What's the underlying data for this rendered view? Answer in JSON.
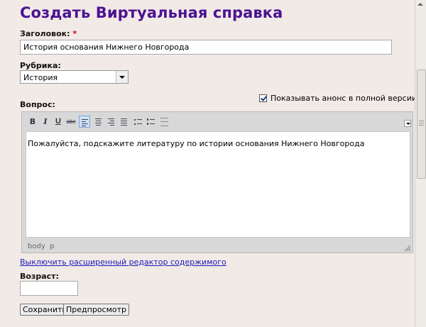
{
  "page": {
    "title": "Создать Виртуальная справка"
  },
  "form": {
    "heading_label": "Заголовок:",
    "required_mark": "*",
    "heading_value": "История основания Нижнего Новгорода",
    "rubric_label": "Рубрика:",
    "rubric_selected": "История",
    "show_preview_label": "Показывать анонс в полной версии",
    "question_label": "Вопрос:",
    "question_text": "Пожалуйста, подскажите литературу по истории основания Нижнего Новгорода",
    "status_body": "body",
    "status_p": "p",
    "advanced_editor_link": "Выключить расширенный редактор содержимого",
    "age_label": "Возраст:",
    "age_value": "",
    "save_button": "Сохранить",
    "preview_button": "Предпросмотр"
  },
  "toolbar": {
    "bold": "B",
    "italic": "I",
    "underline": "U",
    "strike": "abc",
    "icons": [
      "bold-icon",
      "italic-icon",
      "underline-icon",
      "strikethrough-icon",
      "align-left-icon",
      "align-center-icon",
      "align-right-icon",
      "align-justify-icon",
      "bullet-list-icon",
      "numbered-list-icon",
      "horizontal-rule-icon"
    ]
  },
  "colors": {
    "title": "#4c1191",
    "background": "#f1eae6",
    "link": "#1b1bbb",
    "required": "#cc0000"
  }
}
